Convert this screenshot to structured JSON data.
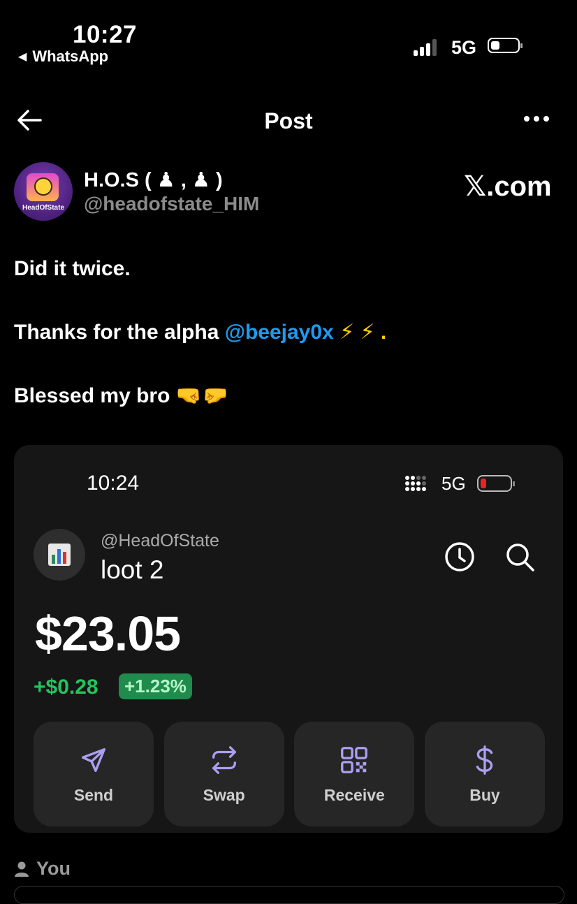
{
  "status_bar": {
    "time": "10:27",
    "back_app": "WhatsApp",
    "network": "5G"
  },
  "header": {
    "title": "Post"
  },
  "author": {
    "name": "H.O.S ( ♟ , ♟ )",
    "handle": "@headofstate_HIM",
    "source": "𝕏.com",
    "avatar_label": "HeadOfState"
  },
  "post": {
    "line1": "Did it twice.",
    "line2_prefix": "Thanks for the alpha ",
    "line2_mention": "@beejay0x",
    "line2_emoji": " ⚡ ⚡ .",
    "line3_text": "Blessed my bro ",
    "line3_emoji": "🤜🤛"
  },
  "embedded": {
    "time": "10:24",
    "network": "5G",
    "handle": "@HeadOfState",
    "account_name": "loot 2",
    "balance": "$23.05",
    "change": "+$0.28",
    "change_pct": "+1.23%",
    "actions": [
      {
        "label": "Send",
        "icon": "send-icon"
      },
      {
        "label": "Swap",
        "icon": "swap-icon"
      },
      {
        "label": "Receive",
        "icon": "qr-icon"
      },
      {
        "label": "Buy",
        "icon": "dollar-icon"
      }
    ],
    "accent_color": "#ab9ff2",
    "positive_color": "#22c55e"
  },
  "footer": {
    "you_label": "You"
  }
}
